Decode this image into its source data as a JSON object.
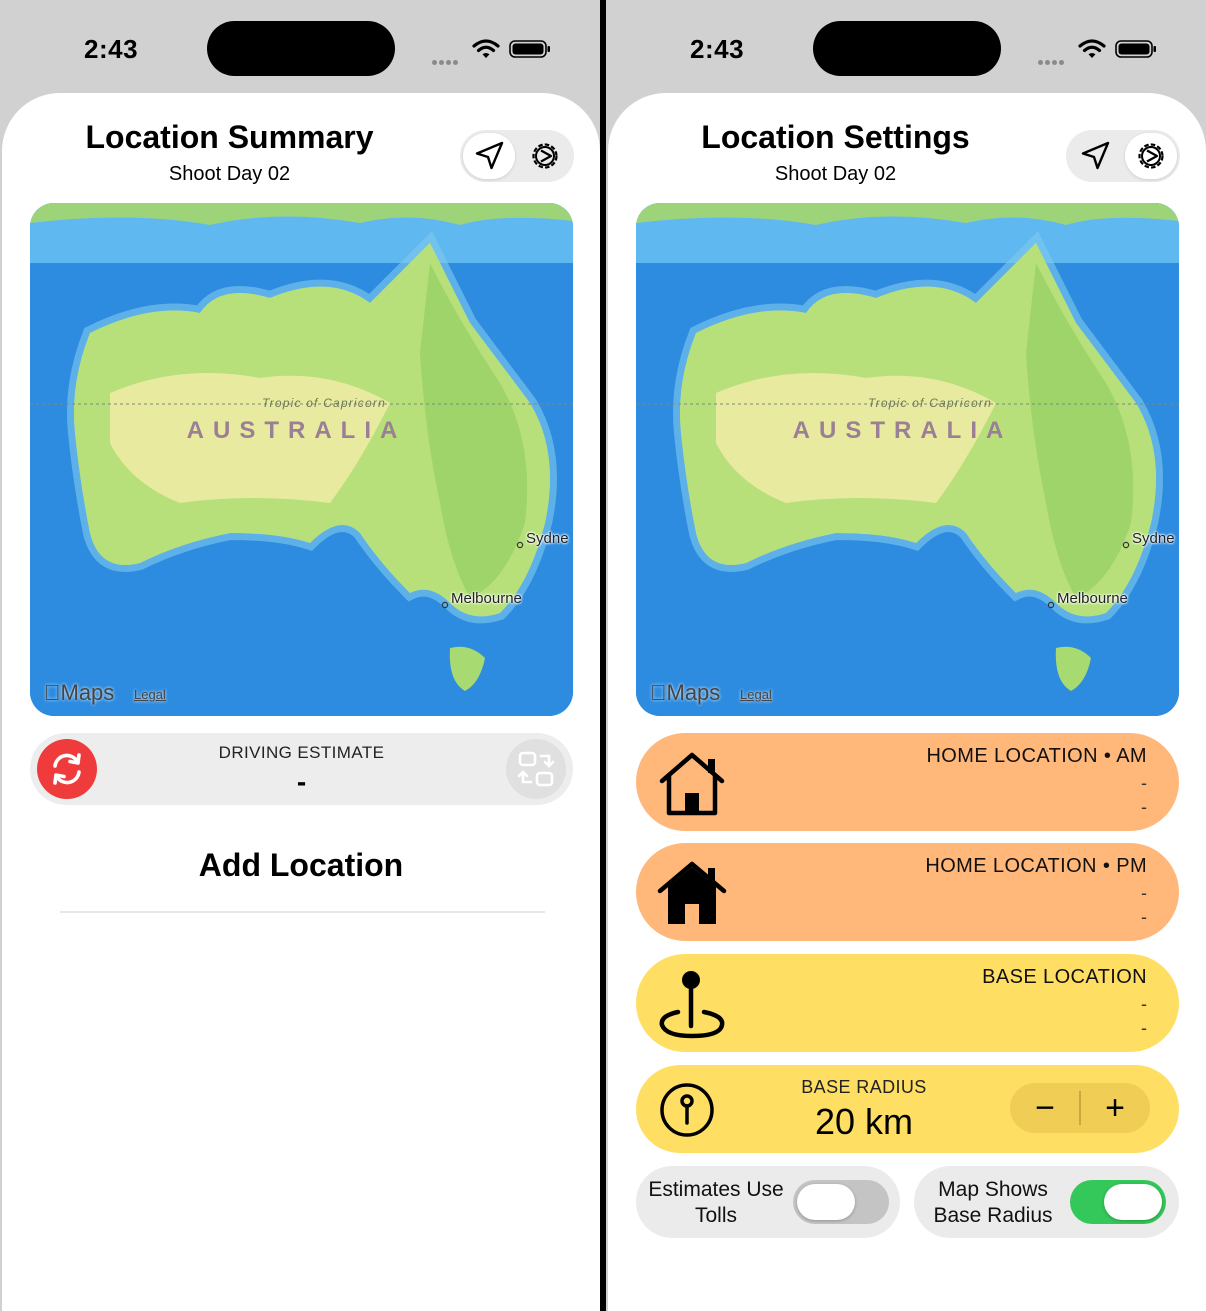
{
  "status": {
    "time": "2:43"
  },
  "map": {
    "country": "AUSTRALIA",
    "tropic": "Tropic of Capricorn",
    "cities": [
      "Sydne",
      "Melbourne"
    ],
    "brand": "Maps",
    "legal": "Legal"
  },
  "summary": {
    "title": "Location Summary",
    "subtitle": "Shoot Day 02",
    "driving_label": "DRIVING ESTIMATE",
    "driving_value": "-",
    "add_location": "Add Location"
  },
  "settings": {
    "title": "Location Settings",
    "subtitle": "Shoot Day 02",
    "home_am": {
      "title": "HOME LOCATION • AM",
      "line1": "-",
      "line2": "-"
    },
    "home_pm": {
      "title": "HOME LOCATION • PM",
      "line1": "-",
      "line2": "-"
    },
    "base": {
      "title": "BASE LOCATION",
      "line1": "-",
      "line2": "-"
    },
    "radius": {
      "label": "BASE RADIUS",
      "value": "20 km",
      "minus": "−",
      "plus": "+"
    },
    "tolls": {
      "label": "Estimates Use Tolls",
      "on": false
    },
    "radius_toggle": {
      "label": "Map Shows Base Radius",
      "on": true
    }
  },
  "colors": {
    "home": "#ffb87a",
    "base": "#ffdf63",
    "refresh": "#ef3b3b",
    "toggle_on": "#34c759"
  }
}
